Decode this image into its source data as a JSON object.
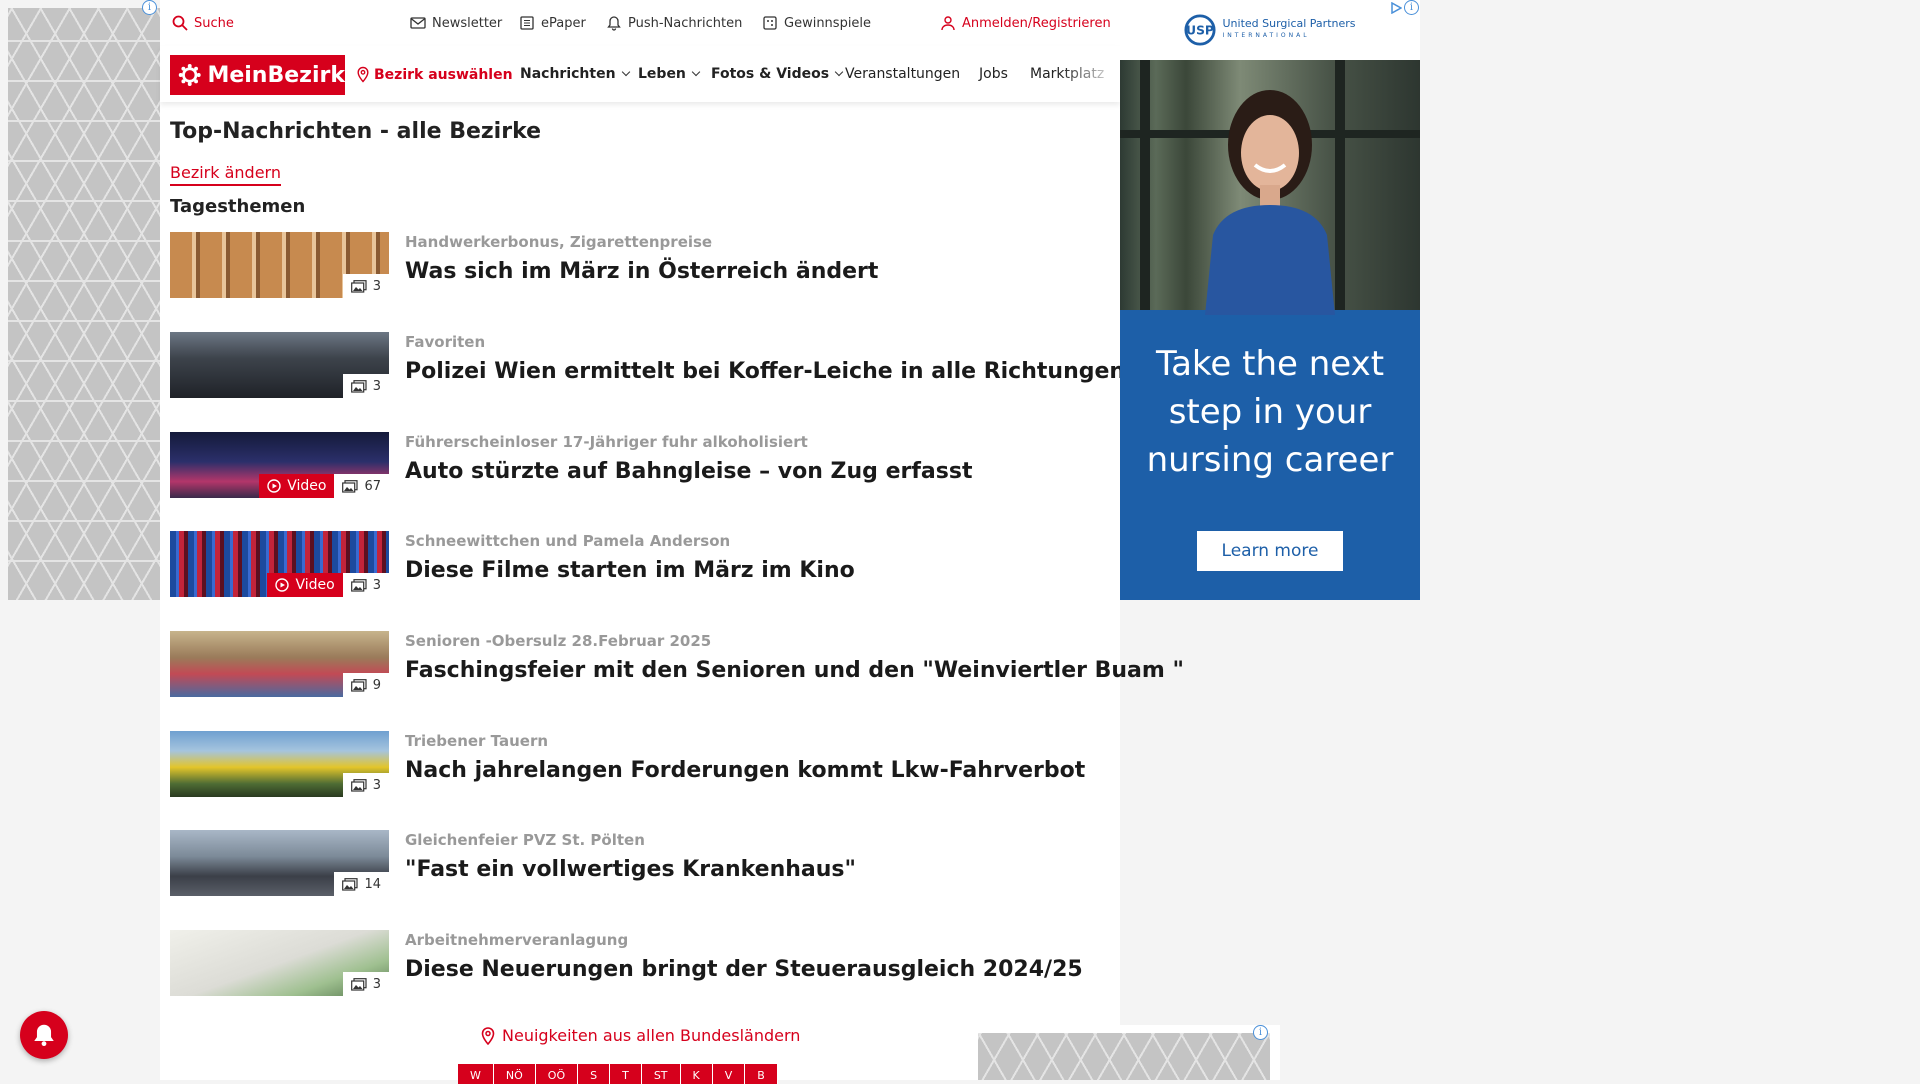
{
  "topbar": {
    "search": "Suche",
    "newsletter": "Newsletter",
    "epaper": "ePaper",
    "push": "Push-Nachrichten",
    "contests": "Gewinnspiele",
    "login": "Anmelden/Registrieren"
  },
  "brand": {
    "logo": "MeinBezirk",
    "accent": "#d6001c"
  },
  "nav": {
    "district": "Bezirk auswählen",
    "items": [
      {
        "label": "Nachrichten",
        "dropdown": true
      },
      {
        "label": "Leben",
        "dropdown": true
      },
      {
        "label": "Fotos & Videos",
        "dropdown": true
      },
      {
        "label": "Veranstaltungen"
      },
      {
        "label": "Jobs"
      },
      {
        "label": "Marktplatz"
      }
    ]
  },
  "page": {
    "title": "Top-Nachrichten - alle Bezirke",
    "change_district": "Bezirk ändern",
    "section": "Tagesthemen"
  },
  "articles": [
    {
      "kicker": "Handwerkerbonus, Zigarettenpreise",
      "headline": "Was sich im März in Österreich ändert",
      "photos": "3",
      "video": false
    },
    {
      "kicker": "Favoriten",
      "headline": "Polizei Wien ermittelt bei Koffer-Leiche in alle Richtungen",
      "photos": "3",
      "video": false
    },
    {
      "kicker": "Führerscheinloser 17-Jähriger fuhr alkoholisiert",
      "headline": "Auto stürzte auf Bahngleise – von Zug erfasst",
      "photos": "67",
      "video": true
    },
    {
      "kicker": "Schneewittchen und Pamela Anderson",
      "headline": "Diese Filme starten im März im Kino",
      "photos": "3",
      "video": true
    },
    {
      "kicker": "Senioren -Obersulz 28.Februar 2025",
      "headline": "Faschingsfeier mit den Senioren und den \"Weinviertler Buam \"",
      "photos": "9",
      "video": false
    },
    {
      "kicker": "Triebener Tauern",
      "headline": "Nach jahrelangen Forderungen kommt Lkw-Fahrverbot",
      "photos": "3",
      "video": false
    },
    {
      "kicker": "Gleichenfeier PVZ St. Pölten",
      "headline": "\"Fast ein vollwertiges Krankenhaus\"",
      "photos": "14",
      "video": false
    },
    {
      "kicker": "Arbeitnehmerveranlagung",
      "headline": "Diese Neuerungen bringt der Steuerausgleich 2024/25",
      "photos": "3",
      "video": false
    }
  ],
  "video_label": "Video",
  "ad": {
    "brand": "United Surgical Partners",
    "brand_sub": "INTERNATIONAL",
    "text": "Take the next step in your nursing career",
    "cta": "Learn more",
    "color": "#1d5fa8"
  },
  "regions": {
    "label": "Neuigkeiten aus allen Bundesländern",
    "states": [
      "W",
      "NÖ",
      "OÖ",
      "S",
      "T",
      "ST",
      "K",
      "V",
      "B"
    ]
  }
}
